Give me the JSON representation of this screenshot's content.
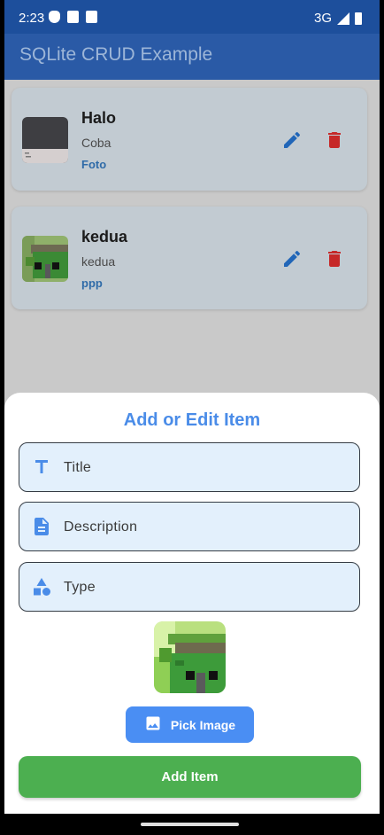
{
  "status_bar": {
    "time": "2:23",
    "network": "3G",
    "icons": [
      "shield-icon",
      "a-icon",
      "sd-card-icon",
      "signal-icon",
      "battery-icon"
    ]
  },
  "app_bar": {
    "title": "SQLite CRUD Example",
    "color": "#2a5aa6"
  },
  "items": [
    {
      "title": "Halo",
      "description": "Coba",
      "type": "Foto",
      "icons": [
        "edit-icon",
        "delete-icon"
      ]
    },
    {
      "title": "kedua",
      "description": "kedua",
      "type": "ppp",
      "icons": [
        "edit-icon",
        "delete-icon"
      ]
    }
  ],
  "sheet": {
    "title": "Add or Edit Item",
    "fields": {
      "title": {
        "placeholder": "Title",
        "value": "",
        "icon": "title-icon"
      },
      "description": {
        "placeholder": "Description",
        "value": "",
        "icon": "description-icon"
      },
      "type": {
        "placeholder": "Type",
        "value": "",
        "icon": "category-icon"
      }
    },
    "pick_image_label": "Pick Image",
    "add_item_label": "Add Item",
    "accent_color": "#4a8ce8",
    "add_button_color": "#4caf50"
  }
}
